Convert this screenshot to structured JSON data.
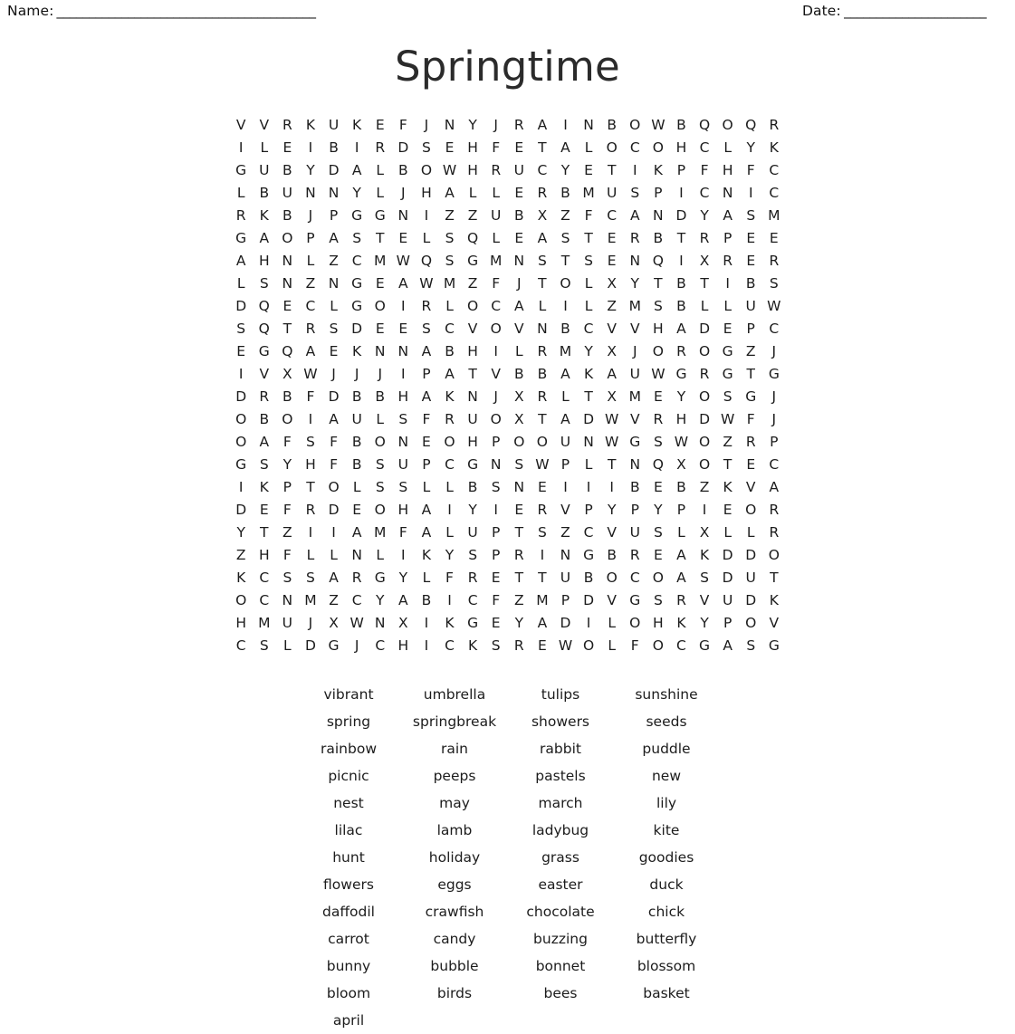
{
  "header": {
    "name_label": "Name:",
    "name_rule": "________________________________________",
    "date_label": "Date:",
    "date_rule": "______________________"
  },
  "title": "Springtime",
  "grid": {
    "rows": 24,
    "cols": 24,
    "letters": [
      [
        "V",
        "V",
        "R",
        "K",
        "U",
        "K",
        "E",
        "F",
        "J",
        "N",
        "Y",
        "J",
        "R",
        "A",
        "I",
        "N",
        "B",
        "O",
        "W",
        "B",
        "Q",
        "O",
        "Q",
        "R"
      ],
      [
        "I",
        "L",
        "E",
        "I",
        "B",
        "I",
        "R",
        "D",
        "S",
        "E",
        "H",
        "F",
        "E",
        "T",
        "A",
        "L",
        "O",
        "C",
        "O",
        "H",
        "C",
        "L",
        "Y",
        "K"
      ],
      [
        "G",
        "U",
        "B",
        "Y",
        "D",
        "A",
        "L",
        "B",
        "O",
        "W",
        "H",
        "R",
        "U",
        "C",
        "Y",
        "E",
        "T",
        "I",
        "K",
        "P",
        "F",
        "H",
        "F",
        "C"
      ],
      [
        "L",
        "B",
        "U",
        "N",
        "N",
        "Y",
        "L",
        "J",
        "H",
        "A",
        "L",
        "L",
        "E",
        "R",
        "B",
        "M",
        "U",
        "S",
        "P",
        "I",
        "C",
        "N",
        "I",
        "C"
      ],
      [
        "R",
        "K",
        "B",
        "J",
        "P",
        "G",
        "G",
        "N",
        "I",
        "Z",
        "Z",
        "U",
        "B",
        "X",
        "Z",
        "F",
        "C",
        "A",
        "N",
        "D",
        "Y",
        "A",
        "S",
        "M"
      ],
      [
        "G",
        "A",
        "O",
        "P",
        "A",
        "S",
        "T",
        "E",
        "L",
        "S",
        "Q",
        "L",
        "E",
        "A",
        "S",
        "T",
        "E",
        "R",
        "B",
        "T",
        "R",
        "P",
        "E",
        "E"
      ],
      [
        "A",
        "H",
        "N",
        "L",
        "Z",
        "C",
        "M",
        "W",
        "Q",
        "S",
        "G",
        "M",
        "N",
        "S",
        "T",
        "S",
        "E",
        "N",
        "Q",
        "I",
        "X",
        "R",
        "E",
        "R"
      ],
      [
        "L",
        "S",
        "N",
        "Z",
        "N",
        "G",
        "E",
        "A",
        "W",
        "M",
        "Z",
        "F",
        "J",
        "T",
        "O",
        "L",
        "X",
        "Y",
        "T",
        "B",
        "T",
        "I",
        "B",
        "S"
      ],
      [
        "D",
        "Q",
        "E",
        "C",
        "L",
        "G",
        "O",
        "I",
        "R",
        "L",
        "O",
        "C",
        "A",
        "L",
        "I",
        "L",
        "Z",
        "M",
        "S",
        "B",
        "L",
        "L",
        "U",
        "W"
      ],
      [
        "S",
        "Q",
        "T",
        "R",
        "S",
        "D",
        "E",
        "E",
        "S",
        "C",
        "V",
        "O",
        "V",
        "N",
        "B",
        "C",
        "V",
        "V",
        "H",
        "A",
        "D",
        "E",
        "P",
        "C"
      ],
      [
        "E",
        "G",
        "Q",
        "A",
        "E",
        "K",
        "N",
        "N",
        "A",
        "B",
        "H",
        "I",
        "L",
        "R",
        "M",
        "Y",
        "X",
        "J",
        "O",
        "R",
        "O",
        "G",
        "Z",
        "J"
      ],
      [
        "I",
        "V",
        "X",
        "W",
        "J",
        "J",
        "J",
        "I",
        "P",
        "A",
        "T",
        "V",
        "B",
        "B",
        "A",
        "K",
        "A",
        "U",
        "W",
        "G",
        "R",
        "G",
        "T",
        "G"
      ],
      [
        "D",
        "R",
        "B",
        "F",
        "D",
        "B",
        "B",
        "H",
        "A",
        "K",
        "N",
        "J",
        "X",
        "R",
        "L",
        "T",
        "X",
        "M",
        "E",
        "Y",
        "O",
        "S",
        "G",
        "J"
      ],
      [
        "O",
        "B",
        "O",
        "I",
        "A",
        "U",
        "L",
        "S",
        "F",
        "R",
        "U",
        "O",
        "X",
        "T",
        "A",
        "D",
        "W",
        "V",
        "R",
        "H",
        "D",
        "W",
        "F",
        "J"
      ],
      [
        "O",
        "A",
        "F",
        "S",
        "F",
        "B",
        "O",
        "N",
        "E",
        "O",
        "H",
        "P",
        "O",
        "O",
        "U",
        "N",
        "W",
        "G",
        "S",
        "W",
        "O",
        "Z",
        "R",
        "P"
      ],
      [
        "G",
        "S",
        "Y",
        "H",
        "F",
        "B",
        "S",
        "U",
        "P",
        "C",
        "G",
        "N",
        "S",
        "W",
        "P",
        "L",
        "T",
        "N",
        "Q",
        "X",
        "O",
        "T",
        "E",
        "C"
      ],
      [
        "I",
        "K",
        "P",
        "T",
        "O",
        "L",
        "S",
        "S",
        "L",
        "L",
        "B",
        "S",
        "N",
        "E",
        "I",
        "I",
        "I",
        "B",
        "E",
        "B",
        "Z",
        "K",
        "V",
        "A"
      ],
      [
        "D",
        "E",
        "F",
        "R",
        "D",
        "E",
        "O",
        "H",
        "A",
        "I",
        "Y",
        "I",
        "E",
        "R",
        "V",
        "P",
        "Y",
        "P",
        "Y",
        "P",
        "I",
        "E",
        "O",
        "R"
      ],
      [
        "Y",
        "T",
        "Z",
        "I",
        "I",
        "A",
        "M",
        "F",
        "A",
        "L",
        "U",
        "P",
        "T",
        "S",
        "Z",
        "C",
        "V",
        "U",
        "S",
        "L",
        "X",
        "L",
        "L",
        "R"
      ],
      [
        "Z",
        "H",
        "F",
        "L",
        "L",
        "N",
        "L",
        "I",
        "K",
        "Y",
        "S",
        "P",
        "R",
        "I",
        "N",
        "G",
        "B",
        "R",
        "E",
        "A",
        "K",
        "D",
        "D",
        "O"
      ],
      [
        "K",
        "C",
        "S",
        "S",
        "A",
        "R",
        "G",
        "Y",
        "L",
        "F",
        "R",
        "E",
        "T",
        "T",
        "U",
        "B",
        "O",
        "C",
        "O",
        "A",
        "S",
        "D",
        "U",
        "T"
      ],
      [
        "O",
        "C",
        "N",
        "M",
        "Z",
        "C",
        "Y",
        "A",
        "B",
        "I",
        "C",
        "F",
        "Z",
        "M",
        "P",
        "D",
        "V",
        "G",
        "S",
        "R",
        "V",
        "U",
        "D",
        "K"
      ],
      [
        "H",
        "M",
        "U",
        "J",
        "X",
        "W",
        "N",
        "X",
        "I",
        "K",
        "G",
        "E",
        "Y",
        "A",
        "D",
        "I",
        "L",
        "O",
        "H",
        "K",
        "Y",
        "P",
        "O",
        "V"
      ],
      [
        "C",
        "S",
        "L",
        "D",
        "G",
        "J",
        "C",
        "H",
        "I",
        "C",
        "K",
        "S",
        "R",
        "E",
        "W",
        "O",
        "L",
        "F",
        "O",
        "C",
        "G",
        "A",
        "S",
        "G"
      ]
    ]
  },
  "word_list": {
    "columns": 4,
    "words": [
      "vibrant",
      "umbrella",
      "tulips",
      "sunshine",
      "spring",
      "springbreak",
      "showers",
      "seeds",
      "rainbow",
      "rain",
      "rabbit",
      "puddle",
      "picnic",
      "peeps",
      "pastels",
      "new",
      "nest",
      "may",
      "march",
      "lily",
      "lilac",
      "lamb",
      "ladybug",
      "kite",
      "hunt",
      "holiday",
      "grass",
      "goodies",
      "flowers",
      "eggs",
      "easter",
      "duck",
      "daffodil",
      "crawfish",
      "chocolate",
      "chick",
      "carrot",
      "candy",
      "buzzing",
      "butterfly",
      "bunny",
      "bubble",
      "bonnet",
      "blossom",
      "bloom",
      "birds",
      "bees",
      "basket",
      "april"
    ]
  },
  "colors": {
    "text": "#1c1c1c",
    "title": "#2b2b2b",
    "background": "#ffffff"
  }
}
